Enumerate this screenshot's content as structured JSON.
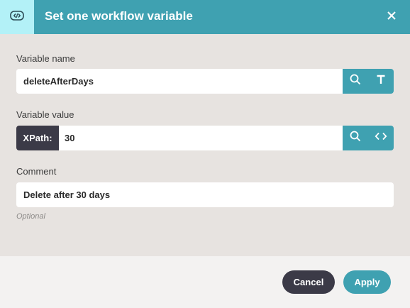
{
  "dialog": {
    "title": "Set one workflow variable",
    "badge_icon": "variable-icon",
    "close_icon": "close-icon"
  },
  "variable_name": {
    "label": "Variable name",
    "value": "deleteAfterDays",
    "buttons": [
      "search-icon",
      "text-type-icon"
    ]
  },
  "variable_value": {
    "label": "Variable value",
    "prefix": "XPath:",
    "value": "30",
    "buttons": [
      "search-icon",
      "code-icon"
    ]
  },
  "comment": {
    "label": "Comment",
    "value": "Delete after 30 days",
    "hint": "Optional"
  },
  "footer": {
    "cancel_label": "Cancel",
    "apply_label": "Apply"
  },
  "colors": {
    "header": "#3fa1b1",
    "badge": "#b3f1f7",
    "body": "#e7e3e0",
    "dark": "#3b3a47",
    "footer": "#f3f2f1"
  }
}
